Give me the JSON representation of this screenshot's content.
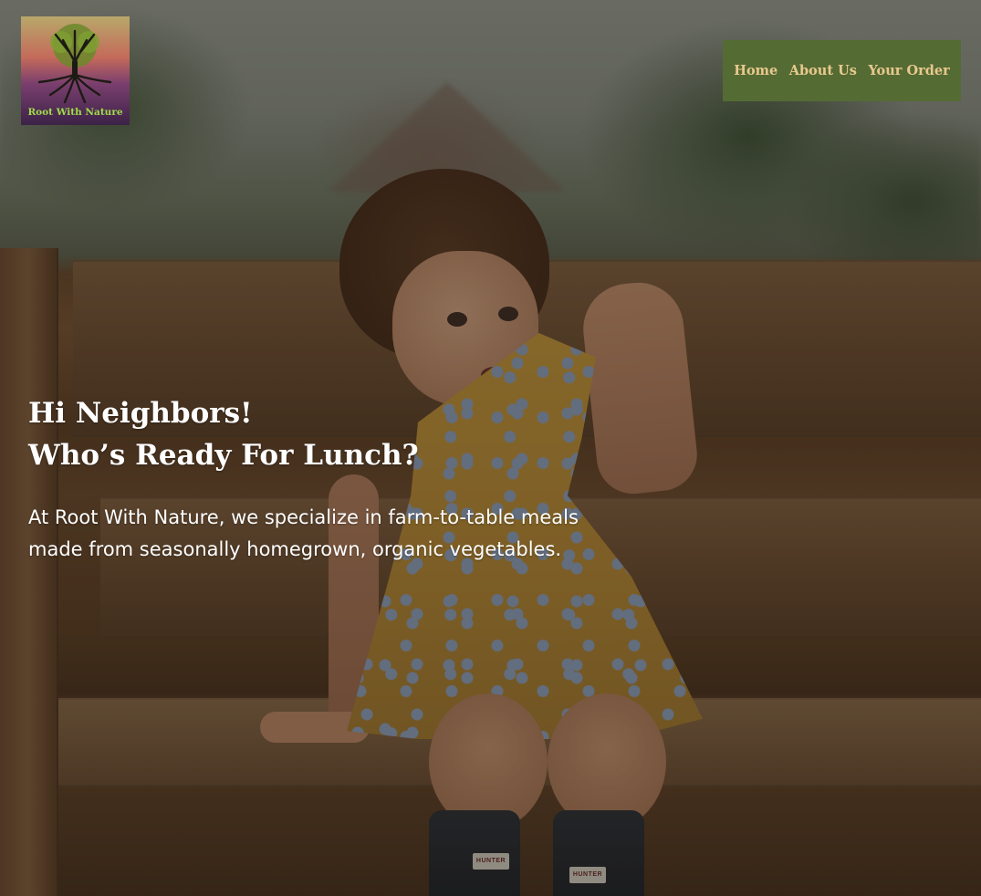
{
  "logo": {
    "text": "Root With Nature",
    "icon": "tree-roots-icon",
    "text_color": "#9fdc4a"
  },
  "nav": {
    "background": "#556b34",
    "link_color": "#e8c98d",
    "items": [
      {
        "label": "Home"
      },
      {
        "label": "About Us"
      },
      {
        "label": "Your Order"
      }
    ]
  },
  "hero": {
    "image": "child-on-wooden-bench-photo",
    "headline_line1": "Hi Neighbors!",
    "headline_line2": "Who’s Ready For Lunch?",
    "tagline": "At Root With Nature, we specialize in farm-to-table meals made from seasonally homegrown, organic vegetables.",
    "boot_brand": "HUNTER"
  }
}
